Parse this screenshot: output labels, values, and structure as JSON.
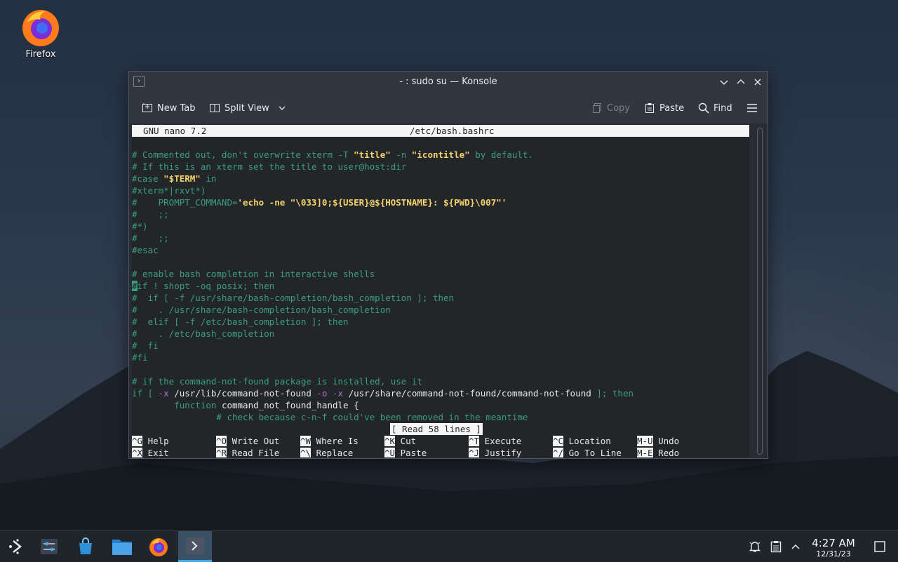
{
  "desktop": {
    "firefox_label": "Firefox"
  },
  "window": {
    "title": "- : sudo su — Konsole",
    "toolbar": {
      "new_tab": "New Tab",
      "split_view": "Split View",
      "copy": "Copy",
      "paste": "Paste",
      "find": "Find"
    }
  },
  "nano": {
    "version": "GNU nano 7.2",
    "file": "/etc/bash.bashrc",
    "status": "[ Read 58 lines ]",
    "shortcuts": [
      {
        "key": "^G",
        "label": "Help"
      },
      {
        "key": "^O",
        "label": "Write Out"
      },
      {
        "key": "^W",
        "label": "Where Is"
      },
      {
        "key": "^K",
        "label": "Cut"
      },
      {
        "key": "^T",
        "label": "Execute"
      },
      {
        "key": "^C",
        "label": "Location"
      },
      {
        "key": "M-U",
        "label": "Undo"
      },
      {
        "key": "^X",
        "label": "Exit"
      },
      {
        "key": "^R",
        "label": "Read File"
      },
      {
        "key": "^\\",
        "label": "Replace"
      },
      {
        "key": "^U",
        "label": "Paste"
      },
      {
        "key": "^J",
        "label": "Justify"
      },
      {
        "key": "^/",
        "label": "Go To Line"
      },
      {
        "key": "M-E",
        "label": "Redo"
      }
    ],
    "lines": {
      "l1a": "# Commented out, don't overwrite xterm -T ",
      "l1b": "\"title\"",
      "l1c": " -n ",
      "l1d": "\"icontitle\"",
      "l1e": " by default.",
      "l2": "# If this is an xterm set the title to user@host:dir",
      "l3a": "#case ",
      "l3b": "\"$TERM\"",
      "l3c": " in",
      "l4": "#xterm*|rxvt*)",
      "l5a": "#    PROMPT_COMMAND=",
      "l5b": "'echo -ne \"\\033]0;${USER}@${HOSTNAME}: ${PWD}\\007\"'",
      "l6": "#    ;;",
      "l7": "#*)",
      "l8": "#    ;;",
      "l9": "#esac",
      "l10": "# enable bash completion in interactive shells",
      "l11a": "#",
      "l11b": "if ! shopt -oq posix; then",
      "l12": "#  if [ -f /usr/share/bash-completion/bash_completion ]; then",
      "l13": "#    . /usr/share/bash-completion/bash_completion",
      "l14": "#  elif [ -f /etc/bash_completion ]; then",
      "l15": "#    . /etc/bash_completion",
      "l16": "#  fi",
      "l17": "#fi",
      "l18": "# if the command-not-found package is installed, use it",
      "l19a": "if [ ",
      "l19b": "-x",
      "l19c": " /usr/lib/command-not-found ",
      "l19d": "-o",
      "l19e": " ",
      "l19f": "-x",
      "l19g": " /usr/share/command-not-found/command-not-found",
      "l19h": " ]; then",
      "l20a": "        function ",
      "l20b": "command_not_found_handle",
      "l20c": " {",
      "l21": "                # check because c-n-f could've been removed in the meantime"
    }
  },
  "taskbar": {
    "time": "4:27 AM",
    "date": "12/31/23"
  }
}
